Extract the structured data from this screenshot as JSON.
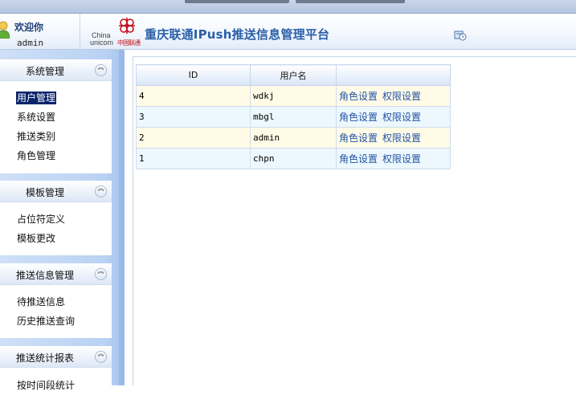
{
  "header": {
    "welcome": "欢迎你",
    "username": "admin",
    "logo_china": "China",
    "logo_unicom": "unicom",
    "logo_cn": "中国联通",
    "title": "重庆联通IPush推送信息管理平台"
  },
  "sidebar": {
    "panels": [
      {
        "title": "系统管理",
        "items": [
          "用户管理",
          "系统设置",
          "推送类别",
          "角色管理"
        ]
      },
      {
        "title": "模板管理",
        "items": [
          "占位符定义",
          "模板更改"
        ]
      },
      {
        "title": "推送信息管理",
        "items": [
          "待推送信息",
          "历史推送查询"
        ]
      },
      {
        "title": "推送统计报表",
        "items": [
          "按时间段统计"
        ]
      }
    ]
  },
  "table": {
    "columns": [
      "ID",
      "用户名",
      ""
    ],
    "rows": [
      {
        "id": "4",
        "username": "wdkj",
        "role_link": "角色设置",
        "perm_link": "权限设置"
      },
      {
        "id": "3",
        "username": "mbgl",
        "role_link": "角色设置",
        "perm_link": "权限设置"
      },
      {
        "id": "2",
        "username": "admin",
        "role_link": "角色设置",
        "perm_link": "权限设置"
      },
      {
        "id": "1",
        "username": "chpn",
        "role_link": "角色设置",
        "perm_link": "权限设置"
      }
    ]
  },
  "icons": {
    "user": "user-icon",
    "logo": "china-unicom-logo",
    "clock": "clock-icon",
    "collapse": "chevron-up-icon"
  },
  "colors": {
    "accent": "#2a5fa8",
    "logo_red": "#c5121c",
    "selected": "#0a246a"
  }
}
